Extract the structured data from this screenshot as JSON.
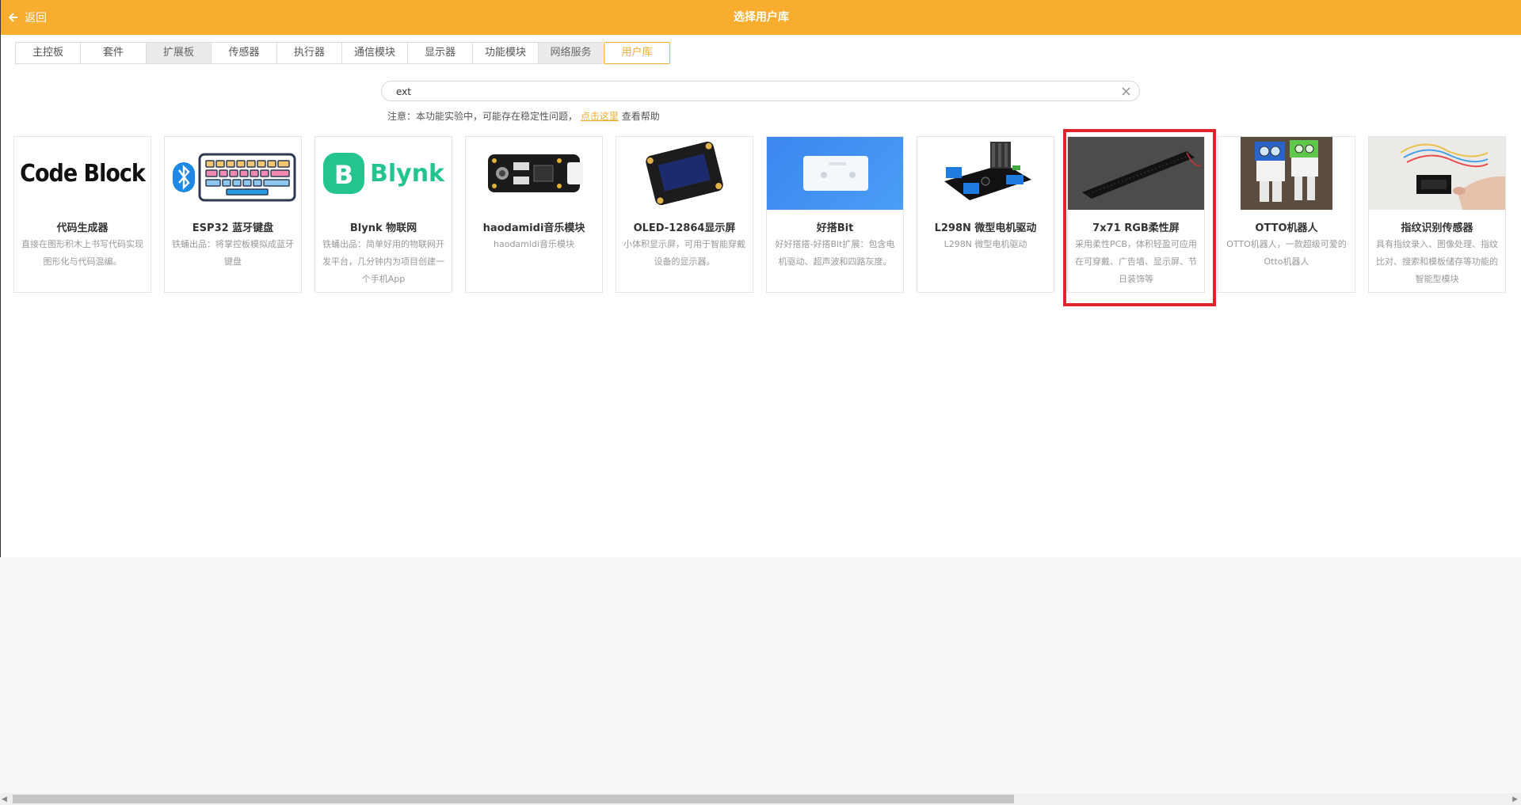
{
  "header": {
    "back_label": "返回",
    "title": "选择用户库"
  },
  "tabs": [
    {
      "label": "主控板",
      "style": "normal"
    },
    {
      "label": "套件",
      "style": "normal"
    },
    {
      "label": "扩展板",
      "style": "gray"
    },
    {
      "label": "传感器",
      "style": "normal"
    },
    {
      "label": "执行器",
      "style": "normal"
    },
    {
      "label": "通信模块",
      "style": "normal"
    },
    {
      "label": "显示器",
      "style": "normal"
    },
    {
      "label": "功能模块",
      "style": "normal"
    },
    {
      "label": "网络服务",
      "style": "gray"
    },
    {
      "label": "用户库",
      "style": "active"
    }
  ],
  "search": {
    "value": "ext"
  },
  "note": {
    "prefix": "注意：本功能实验中，可能存在稳定性问题，",
    "link": "点击这里",
    "suffix": "查看帮助"
  },
  "cards": [
    {
      "name": "代码生成器",
      "desc": "直接在图形积木上书写代码实现图形化与代码混编。",
      "thumb_text": "Code Block",
      "icon": "code-block-logo"
    },
    {
      "name": "ESP32 蓝牙键盘",
      "desc": "铁蛹出品：将掌控板模拟成蓝牙键盘",
      "icon": "bluetooth-keyboard-icon"
    },
    {
      "name": "Blynk 物联网",
      "desc": "铁蛹出品：简单好用的物联网开发平台，几分钟内为项目创建一个手机App",
      "thumb_text": "Blynk",
      "icon": "blynk-logo"
    },
    {
      "name": "haodamidi音乐模块",
      "desc": "haodamidi音乐模块",
      "icon": "music-module-image"
    },
    {
      "name": "OLED-12864显示屏",
      "desc": "小体积显示屏，可用于智能穿戴设备的显示器。",
      "icon": "oled-display-image"
    },
    {
      "name": "好搭Bit",
      "desc": "好好搭搭-好搭Bit扩展：包含电机驱动、超声波和四路灰度。",
      "icon": "haodabit-board-image"
    },
    {
      "name": "L298N 微型电机驱动",
      "desc": "L298N 微型电机驱动",
      "icon": "motor-driver-image"
    },
    {
      "name": "7x71 RGB柔性屏",
      "desc": "采用柔性PCB，体积轻盈可应用在可穿戴、广告墙、显示屏、节日装饰等",
      "icon": "flexible-rgb-strip-image"
    },
    {
      "name": "OTTO机器人",
      "desc": "OTTO机器人，一款超级可爱的Otto机器人",
      "icon": "otto-robot-image"
    },
    {
      "name": "指纹识别传感器",
      "desc": "具有指纹录入、图像处理、指纹比对、搜索和模板储存等功能的智能型模块",
      "icon": "fingerprint-sensor-image"
    }
  ],
  "colors": {
    "accent": "#f8ad2f",
    "highlight": "#e0242c"
  }
}
